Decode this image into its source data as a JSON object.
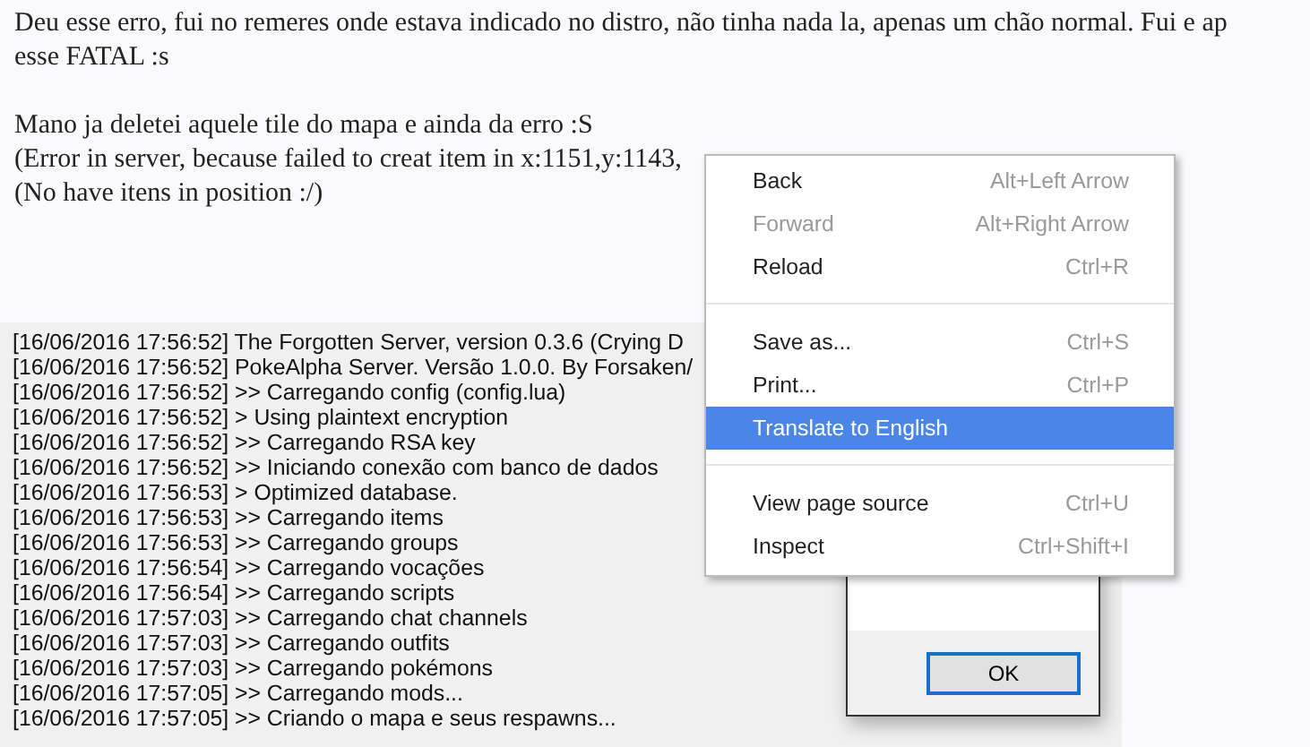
{
  "post": {
    "paragraphs": [
      {
        "lines": [
          "Deu esse erro, fui no remeres onde estava indicado no distro, não tinha nada la, apenas um chão normal. Fui e ap",
          "esse FATAL :s"
        ]
      },
      {
        "lines": [
          "Mano ja deletei aquele tile do mapa e ainda da erro :S",
          "(Error in server, because failed to creat item in x:1151,y:1143,",
          "(No have itens in position :/)"
        ]
      }
    ]
  },
  "console": {
    "lines": [
      "[16/06/2016 17:56:52] The Forgotten Server, version 0.3.6 (Crying D",
      "[16/06/2016 17:56:52] PokeAlpha Server. Versão 1.0.0. By Forsaken/",
      "[16/06/2016 17:56:52] >> Carregando config (config.lua)",
      "[16/06/2016 17:56:52] > Using plaintext encryption",
      "[16/06/2016 17:56:52] >> Carregando RSA key",
      "[16/06/2016 17:56:52] >> Iniciando conexão com banco de dados",
      "[16/06/2016 17:56:53] > Optimized database.",
      "[16/06/2016 17:56:53] >> Carregando items",
      "[16/06/2016 17:56:53] >> Carregando groups",
      "[16/06/2016 17:56:54] >> Carregando vocações",
      "[16/06/2016 17:56:54] >> Carregando scripts",
      "[16/06/2016 17:57:03] >> Carregando chat channels",
      "[16/06/2016 17:57:03] >> Carregando outfits",
      "[16/06/2016 17:57:03] >> Carregando pokémons",
      "[16/06/2016 17:57:05] >> Carregando mods...",
      "[16/06/2016 17:57:05] >> Criando o mapa e seus respawns..."
    ]
  },
  "dialog": {
    "button": "OK"
  },
  "context_menu": {
    "items": [
      {
        "kind": "item",
        "label": "Back",
        "shortcut": "Alt+Left Arrow",
        "disabled": false,
        "selected": false
      },
      {
        "kind": "item",
        "label": "Forward",
        "shortcut": "Alt+Right Arrow",
        "disabled": true,
        "selected": false
      },
      {
        "kind": "item",
        "label": "Reload",
        "shortcut": "Ctrl+R",
        "disabled": false,
        "selected": false
      },
      {
        "kind": "separator"
      },
      {
        "kind": "item",
        "label": "Save as...",
        "shortcut": "Ctrl+S",
        "disabled": false,
        "selected": false
      },
      {
        "kind": "item",
        "label": "Print...",
        "shortcut": "Ctrl+P",
        "disabled": false,
        "selected": false
      },
      {
        "kind": "item",
        "label": "Translate to English",
        "disabled": false,
        "selected": true
      },
      {
        "kind": "separator"
      },
      {
        "kind": "item",
        "label": "View page source",
        "shortcut": "Ctrl+U",
        "disabled": false,
        "selected": false
      },
      {
        "kind": "item",
        "label": "Inspect",
        "shortcut": "Ctrl+Shift+I",
        "disabled": false,
        "selected": false
      }
    ]
  }
}
